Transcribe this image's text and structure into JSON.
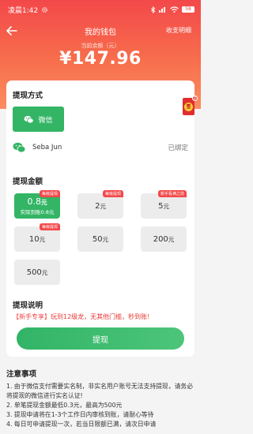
{
  "status_bar": {
    "time": "凌晨1:42",
    "battery": "58"
  },
  "header": {
    "title": "我的钱包",
    "detail_link": "收支明细"
  },
  "balance": {
    "label": "当前余额（元）",
    "value": "¥147.96"
  },
  "withdraw_method": {
    "title": "提现方式",
    "wechat_label": "微信",
    "account_name": "Seba Jun",
    "status": "已绑定"
  },
  "withdraw_amount": {
    "title": "提现金额",
    "options": [
      {
        "value": "0.8",
        "unit": "元",
        "tag": "每级提现",
        "sub": "实际到账0.8元",
        "selected": true
      },
      {
        "value": "2",
        "unit": "元",
        "tag": "每级提现"
      },
      {
        "value": "5",
        "unit": "元",
        "tag": "新手看满之前"
      },
      {
        "value": "10",
        "unit": "元",
        "tag": "每级提现"
      },
      {
        "value": "50",
        "unit": "元"
      },
      {
        "value": "200",
        "unit": "元"
      },
      {
        "value": "500",
        "unit": "元"
      }
    ]
  },
  "withdraw_desc": {
    "title": "提现说明",
    "tag": "【新手专享】",
    "text": "玩到12级龙，无其他门槛，秒到账!"
  },
  "withdraw_button": "提现",
  "red_packet": {
    "seal": "签",
    "badge": "2"
  },
  "notice": {
    "title": "注意事项",
    "items": [
      "1. 由于微信支付需要实名制，非实名用户账号无法支持提现，请务必将提现的微信进行实名认证!",
      "2. 单笔提现金额最低0.3元，最高为500元",
      "3. 提现申请将在1-3个工作日内审核到账，请耐心等待",
      "4. 每日可申请提现一次，若当日限额已满，请次日申请"
    ]
  },
  "colors": {
    "header_red": "#f3484a",
    "accent_green": "#33b565"
  }
}
